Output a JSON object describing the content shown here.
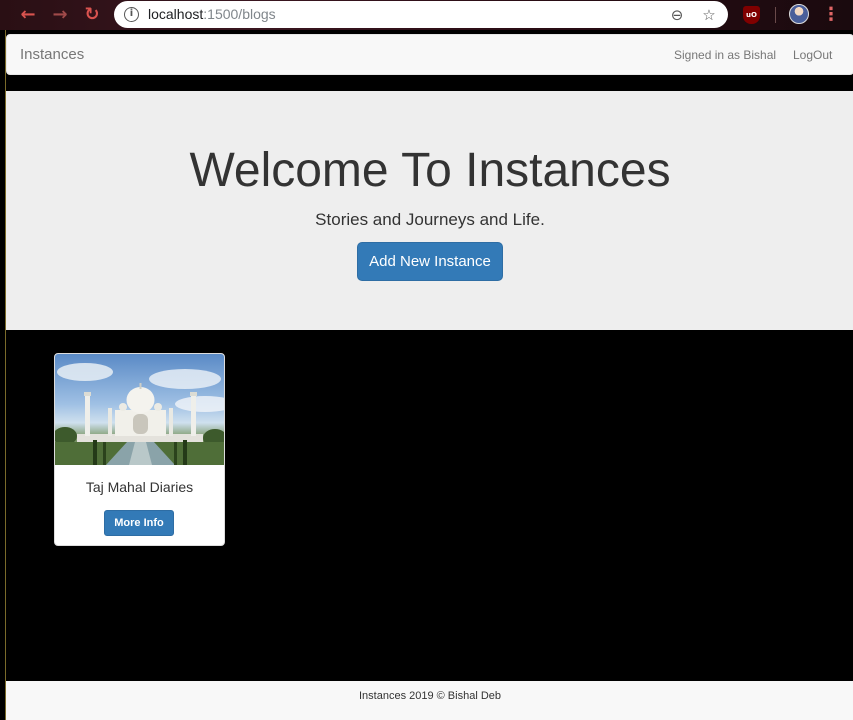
{
  "browser": {
    "url_host": "localhost",
    "url_path": ":1500/blogs",
    "icons": {
      "back": "back-arrow-icon",
      "forward": "forward-arrow-icon",
      "reload": "reload-icon",
      "info": "info-icon",
      "zoom": "zoom-out-icon",
      "bookmark": "star-icon",
      "extension": "ublock-icon",
      "menu": "kebab-menu-icon"
    },
    "extension_badge": "uO"
  },
  "navbar": {
    "brand": "Instances",
    "signed_in": "Signed in as Bishal",
    "logout": "LogOut"
  },
  "jumbotron": {
    "title": "Welcome To Instances",
    "subtitle": "Stories and Journeys and Life.",
    "button": "Add New Instance"
  },
  "cards": [
    {
      "title": "Taj Mahal Diaries",
      "button": "More Info"
    }
  ],
  "footer": {
    "text": "Instances 2019 © Bishal Deb"
  },
  "colors": {
    "primary": "#337ab7",
    "jumbotron_bg": "#eeeeee",
    "page_bg": "#000000",
    "navbar_bg": "#f8f8f8"
  }
}
